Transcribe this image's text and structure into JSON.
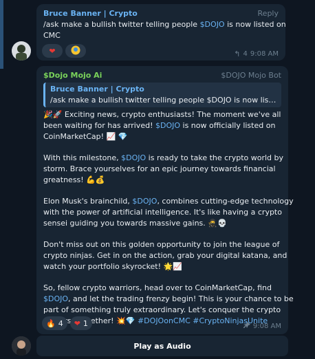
{
  "message1": {
    "sender": "Bruce Banner | Crypto",
    "reply_label": "Reply",
    "line1_pre": "/ask make a bullish twitter telling people ",
    "line1_tag": "$DOJO",
    "line1_post": " is now listed on",
    "line2": "CMC",
    "reactions": [
      {
        "emoji": "❤",
        "icon": "heart-icon"
      },
      {
        "emoji": "🧑",
        "icon": "sticker-face-icon"
      }
    ],
    "views": "4",
    "time": "9:08 AM"
  },
  "message2": {
    "sender": "$Dojo Mojo Ai",
    "badge": "$DOJO Mojo Bot",
    "reply": {
      "name": "Bruce Banner | Crypto",
      "text": "/ask make a bullish twitter telling people $DOJO is now listed ..."
    },
    "p1": {
      "l1": " Exciting news, crypto enthusiasts! The moment we've all",
      "l2_pre": "been waiting for has arrived! ",
      "l2_tag": "$DOJO",
      "l2_post": " is now officially listed on",
      "l3": "CoinMarketCap! "
    },
    "p2": {
      "l1_pre": "With this milestone, ",
      "l1_tag": "$DOJO",
      "l1_post": " is ready to take the crypto world by",
      "l2": "storm. Brace yourselves for an epic journey towards financial",
      "l3": "greatness! "
    },
    "p3": {
      "l1_pre": "Elon Musk's brainchild, ",
      "l1_tag": "$DOJO",
      "l1_post": ", combines cutting-edge technology",
      "l2": "with the power of artificial intelligence. It's like having a crypto",
      "l3": "sensei guiding you towards massive gains. "
    },
    "p4": {
      "l1": "Don't miss out on this golden opportunity to join the league of",
      "l2": "crypto ninjas. Get in on the action, grab your digital katana, and",
      "l3": "watch your portfolio skyrocket! "
    },
    "p5": {
      "l1": "So, fellow crypto warriors, head over to CoinMarketCap, find",
      "l2_tag": "$DOJO",
      "l2_post": ", and let the trading frenzy begin! This is your chance to be",
      "l3": "part of something truly extraordinary. Let's conquer the crypto",
      "l4_pre": "universe together! ",
      "l4_tags": "#DOJOonCMC #CryptoNinjasUnite"
    },
    "reactions": [
      {
        "emoji": "🔥",
        "count": "4",
        "icon": "fire-icon"
      },
      {
        "emoji": "❤",
        "count": "1",
        "icon": "heart-icon"
      }
    ],
    "time": "9:08 AM"
  },
  "audio": {
    "label": "Play as Audio"
  },
  "colors": {
    "background": "#0e1621",
    "bubble": "#182533",
    "link": "#6ab3f3",
    "bot_name": "#7ad25a"
  }
}
